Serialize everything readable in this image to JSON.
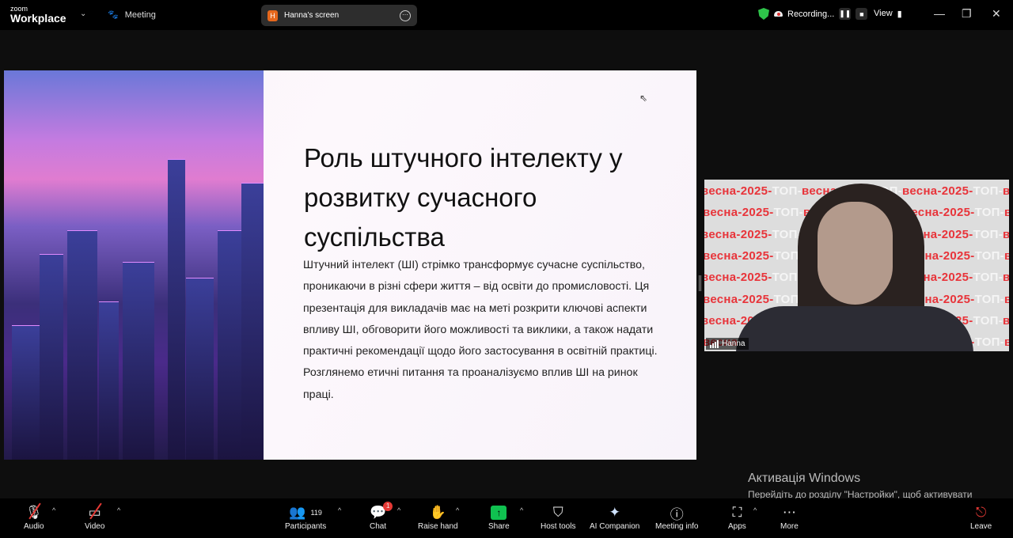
{
  "app": {
    "logo_small": "zoom",
    "logo_big": "Workplace",
    "meeting_label": "Meeting"
  },
  "share_pill": {
    "initial": "H",
    "label": "Hanna's screen"
  },
  "status": {
    "recording": "Recording...",
    "view": "View"
  },
  "slide": {
    "title": "Роль штучного інтелекту у розвитку сучасного суспільства",
    "body": "Штучний інтелект (ШІ) стрімко трансформує сучасне суспільство, проникаючи в різні сфери життя – від освіти до промисловості. Ця презентація для викладачів має на меті розкрити ключові аспекти впливу ШІ, обговорити його можливості та виклики, а також надати практичні рекомендації щодо його застосування в освітній практиці. Розглянемо етичні питання та проаналізуємо вплив ШІ на ринок праці."
  },
  "video": {
    "name": "Hanna",
    "backdrop_red": "весна-2025-",
    "backdrop_white": "ТОП-"
  },
  "watermark": {
    "title": "Активація Windows",
    "subtitle": "Перейдіть до розділу \"Настройки\", щоб активувати Windows."
  },
  "toolbar": {
    "audio": "Audio",
    "video": "Video",
    "participants": "Participants",
    "participants_count": "119",
    "chat": "Chat",
    "chat_badge": "1",
    "raise_hand": "Raise hand",
    "share": "Share",
    "host_tools": "Host tools",
    "ai_companion": "AI Companion",
    "meeting_info": "Meeting info",
    "apps": "Apps",
    "more": "More",
    "leave": "Leave"
  },
  "colors": {
    "share_green": "#10c150",
    "badge_red": "#e53935",
    "secure_green": "#2ec44a"
  }
}
